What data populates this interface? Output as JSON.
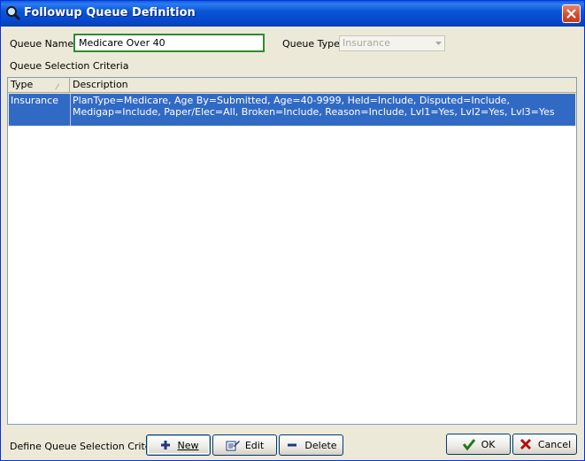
{
  "window": {
    "title": "Followup Queue Definition",
    "close_icon": "close-icon"
  },
  "form": {
    "queue_name_label": "Queue Name",
    "queue_name_value": "Medicare Over 40",
    "queue_type_label": "Queue Type",
    "queue_type_value": "Insurance",
    "criteria_label": "Queue Selection Criteria"
  },
  "grid": {
    "columns": [
      "Type",
      "Description"
    ],
    "rows": [
      {
        "type": "Insurance",
        "description": "PlanType=Medicare, Age By=Submitted, Age=40-9999, Held=Include, Disputed=Include, Medigap=Include, Paper/Elec=All, Broken=Include, Reason=Include, Lvl1=Yes, Lvl2=Yes, Lvl3=Yes",
        "selected": true
      }
    ]
  },
  "footer": {
    "define_label": "Define Queue Selection Criteria",
    "new_label": "New",
    "edit_label": "Edit",
    "delete_label": "Delete",
    "ok_label": "OK",
    "cancel_label": "Cancel"
  },
  "colors": {
    "selection": "#316ac5",
    "title_bar": "#0a56d8",
    "dialog_bg": "#ece9d8",
    "input_border": "#2e8b2e"
  }
}
